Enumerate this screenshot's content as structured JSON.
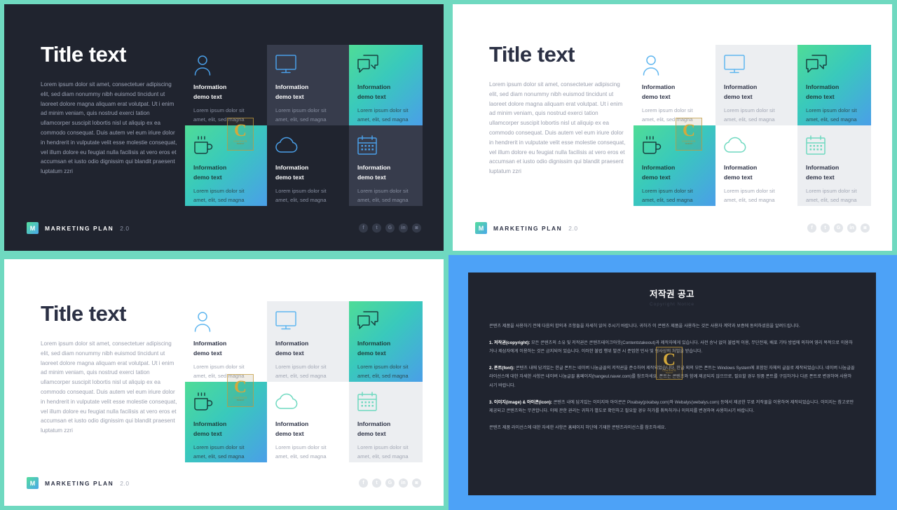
{
  "slide": {
    "title": "Title text",
    "body": "Lorem ipsum dolor sit amet, consectetuer adipiscing elit, sed diam nonummy nibh euismod tincidunt ut laoreet dolore magna aliquam erat volutpat. Ut i enim ad minim veniam, quis nostrud exerci tation ullamcorper suscipit lobortis nisl ut aliquip ex ea commodo consequat. Duis autem vel eum iriure dolor in hendrerit in vulputate velit esse molestie consequat, vel illum dolore eu feugiat nulla facilisis at vero eros et accumsan et iusto odio dignissim qui blandit praesent luptatum zzri",
    "cards": [
      {
        "icon": "user-icon",
        "title": "Information demo text",
        "desc": "Lorem ipsum dolor sit amet, elit, sed magna",
        "style": "plain"
      },
      {
        "icon": "monitor-icon",
        "title": "Information demo text",
        "desc": "Lorem ipsum dolor sit amet, elit, sed magna",
        "style": "soft"
      },
      {
        "icon": "chat-icon",
        "title": "Information demo text",
        "desc": "Lorem ipsum dolor sit amet, elit, sed magna",
        "style": "grad"
      },
      {
        "icon": "coffee-icon",
        "title": "Information demo text",
        "desc": "Lorem ipsum dolor sit amet, elit, sed magna",
        "style": "grad"
      },
      {
        "icon": "cloud-icon",
        "title": "Information demo text",
        "desc": "Lorem ipsum dolor sit amet, elit, sed magna",
        "style": "plain"
      },
      {
        "icon": "calendar-icon",
        "title": "Information demo text",
        "desc": "Lorem ipsum dolor sit amet, elit, sed magna",
        "style": "soft"
      }
    ],
    "footer": {
      "logo_letter": "M",
      "brand_name": "MARKETING PLAN",
      "version": "2.0",
      "socials": [
        "facebook-icon",
        "twitter-icon",
        "googleplus-icon",
        "linkedin-icon",
        "instagram-icon"
      ]
    }
  },
  "watermark": {
    "letter": "C",
    "line1": "CONTENTS",
    "line2": "TAKEOUT"
  },
  "copyright": {
    "title": "저작권 공고",
    "subtitle": "Copyright Notice",
    "paragraphs": [
      {
        "lead": "",
        "text": "콘텐츠 제품을 사용하기 전에 다음의 합의과 조항들을 자세히 읽어 주시기 바랍니다. 귀하가 이 콘텐츠 제품을 사용하는 것은 사용자 계약과 보증에 동의하셨음을 알려드립니다."
      },
      {
        "lead": "1. 저작권(copyright):",
        "text": " 모든 콘텐츠의 소유 및 저작권은 콘텐츠테이크아웃(Contentstakeout)과 제작자에게 있습니다. 사전 승낙 없이 불법적 이용, 무단전재, 배포 기타 방법에 의하여 영리 목적으로 이용하거나 제삼자에게 이용하는 것은 금지되어 있습니다. 이러한 불법 행위 발견 시 준엄한 민사 및 형사상의 처벌을 받습니다."
      },
      {
        "lead": "2. 폰트(font):",
        "text": " 콘텐츠 내에 담겨있는 한글 폰트는 네이버 나눔글꼴의 저작권을 준수하여 제작되었습니다. 한글 외의 모든 폰트는 Windows System에 포함된 자체의 글꼴로 제작되었습니다. 네이버 나눔글꼴 라이선스에 대한 자세한 사항은 네이버 나눔글꼴 홈페이지(hangeul.naver.com)를 참조하세요. 폰트는 콘텐츠와 함께 제공되지 않으므로, 필요할 경우 정품 폰트를 구입하거나 다른 폰트로 변경하여 사용하시기 바랍니다."
      },
      {
        "lead": "3. 이미지(image) & 아이콘(icon):",
        "text": " 콘텐츠 내에 담겨있는 이미지와 아이콘은 Pixabay(pixabay.com)와 Webalys(webalys.com) 등에서 제공한 무료 저작물을 이용하여 제작되었습니다. 이미지는 참고로만 제공되고 콘텐츠와는 무관합니다. 이에 관한 권리는 귀하가 별도로 확인하고 필요할 경우 허가를 취득하거나 이미지를 변경하여 사용하시기 바랍니다."
      },
      {
        "lead": "",
        "text": "콘텐츠 제품 라이선스에 대한 자세한 사항은 홈페이지 하단에 기재한 콘텐츠라이선스를 참조하세요."
      }
    ]
  },
  "colors": {
    "teal_border": "#6fd9c0",
    "blue_border": "#4da2f7",
    "dark_bg": "#20242f",
    "grad_start": "#4fdc97",
    "grad_end": "#4a9fe8",
    "icon_blue": "#4a9fe8",
    "gold": "#d4a93c"
  }
}
